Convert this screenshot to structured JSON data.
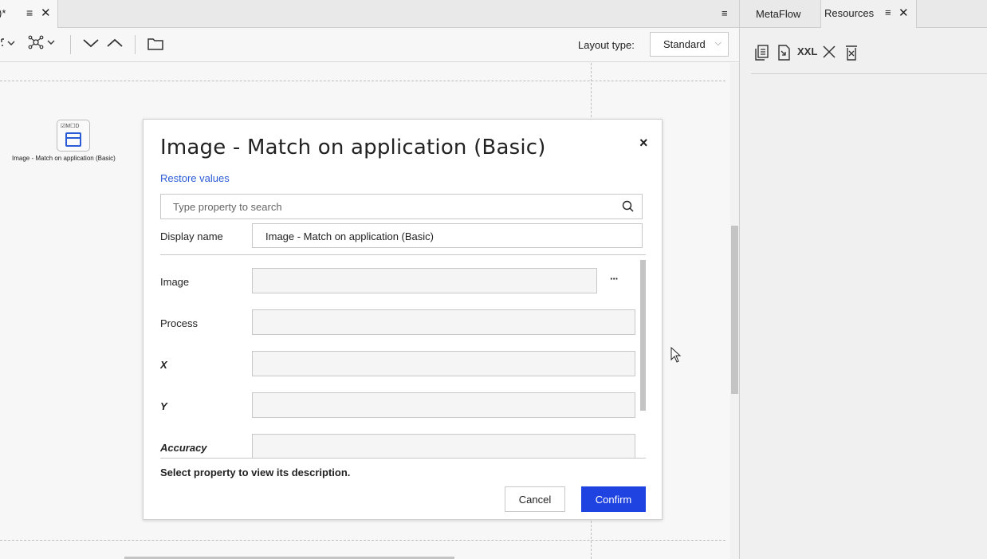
{
  "editor": {
    "doc_tab": {
      "title": ")*",
      "menu_icon": "≡",
      "close_icon": "✕"
    },
    "tabbar_menu_icon": "≡",
    "toolbar": {
      "icons": [
        "expand-icon",
        "network-icon",
        "chevron-down-icon",
        "chevron-up-icon",
        "folder-icon"
      ],
      "layout_type_label": "Layout type:",
      "layout_type_value": "Standard"
    },
    "node": {
      "badges": "☑M☐D",
      "label": "Image - Match on application (Basic)"
    }
  },
  "right_panel": {
    "tabs": [
      {
        "label": "MetaFlow"
      },
      {
        "label": "Resources",
        "menu_icon": "≡",
        "close_icon": "✕"
      }
    ],
    "toolbar": {
      "xxl_label": "XXL"
    }
  },
  "dialog": {
    "title": "Image - Match on application (Basic)",
    "close_icon": "×",
    "restore_label": "Restore values",
    "search_placeholder": "Type property to search",
    "display_name_label": "Display name",
    "display_name_value": "Image - Match on application (Basic)",
    "properties": [
      {
        "label": "Image",
        "value": "",
        "required": false,
        "has_browse": true
      },
      {
        "label": "Process",
        "value": "",
        "required": false
      },
      {
        "label": "X",
        "value": "",
        "required": true
      },
      {
        "label": "Y",
        "value": "",
        "required": true
      },
      {
        "label": "Accuracy",
        "value": "",
        "required": true
      }
    ],
    "browse_label": "···",
    "description": "Select property to view its description.",
    "cancel_label": "Cancel",
    "confirm_label": "Confirm",
    "accent_color": "#1f43e0"
  }
}
